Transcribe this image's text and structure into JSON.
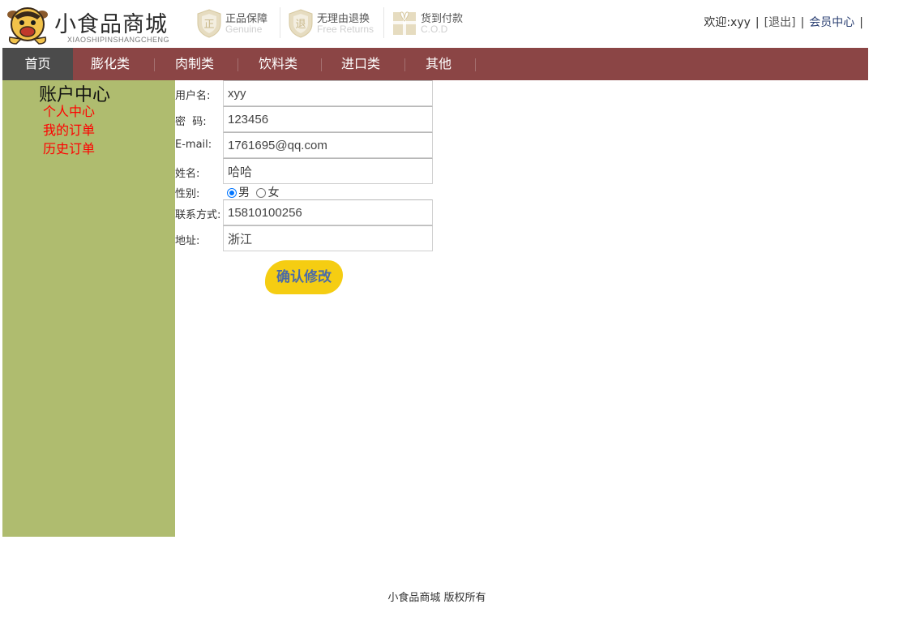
{
  "header": {
    "brand_name": "小食品商城",
    "brand_subtitle": "XIAOSHIPINSHANGCHENG",
    "promises": [
      {
        "icon": "genuine-shield-icon",
        "title": "正品保障",
        "subtitle": "Genuine"
      },
      {
        "icon": "return-shield-icon",
        "title": "无理由退换",
        "subtitle": "Free Returns"
      },
      {
        "icon": "gift-icon",
        "title": "货到付款",
        "subtitle": "C.O.D"
      }
    ],
    "user_bar": {
      "welcome": "欢迎:xyy",
      "sep1": "|",
      "logout": "[退出]",
      "sep2": "|",
      "member_center": "会员中心",
      "sep3": "|"
    }
  },
  "nav": {
    "items": [
      "首页",
      "膨化类",
      "肉制类",
      "饮料类",
      "进口类",
      "其他"
    ],
    "active": "首页"
  },
  "sidebar": {
    "title": "账户中心",
    "links": [
      "个人中心",
      "我的订单",
      "历史订单"
    ]
  },
  "form": {
    "username_label": "用户名:",
    "username_value": "xyy",
    "password_label": "密  码:",
    "password_value": "123456",
    "email_label": "E-mail:",
    "email_value": "1761695@qq.com",
    "name_label": "姓名:",
    "name_value": "哈哈",
    "gender_label": "性别:",
    "gender_male": "男",
    "gender_female": "女",
    "gender_selected": "男",
    "phone_label": "联系方式:",
    "phone_value": "15810100256",
    "address_label": "地址:",
    "address_value": "浙江",
    "submit_label": "确认修改"
  },
  "footer": {
    "copyright": "小食品商城 版权所有"
  },
  "colors": {
    "nav_bg": "#8b4545",
    "nav_active_bg": "#4b4b4b",
    "sidebar_bg": "#afbc6f",
    "sidebar_link": "#ff0000",
    "submit_bg": "#f5cd12",
    "submit_text": "#4a6aa8"
  }
}
